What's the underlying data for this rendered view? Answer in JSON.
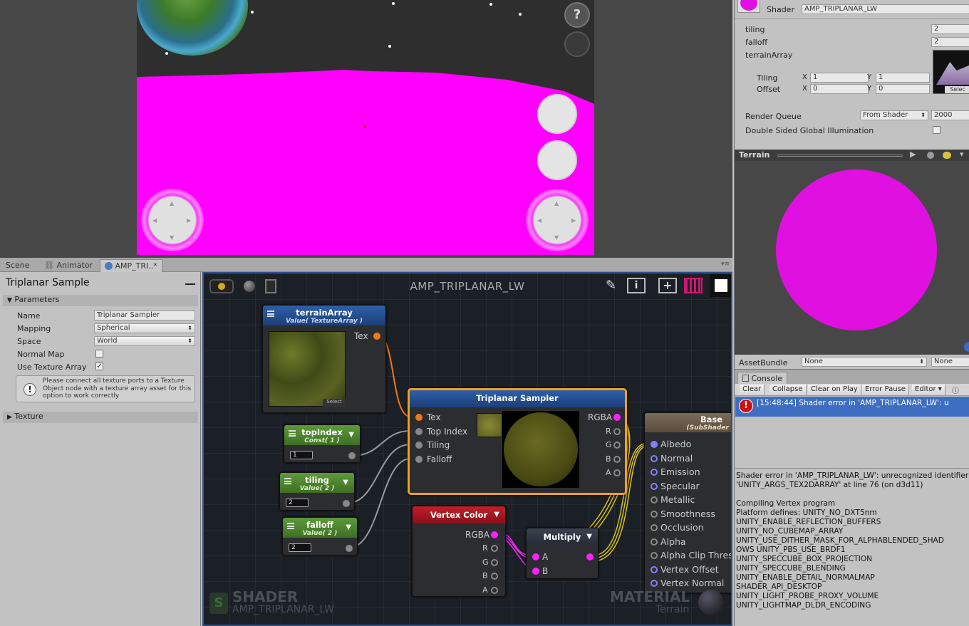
{
  "game": {
    "help_button": "?"
  },
  "tabs": [
    {
      "label": "Scene"
    },
    {
      "label": "Animator"
    },
    {
      "label": "AMP_TRI..*"
    }
  ],
  "left_panel": {
    "title": "Triplanar Sample",
    "section_parameters": "Parameters",
    "name_label": "Name",
    "name_value": "Triplanar Sampler",
    "mapping_label": "Mapping",
    "mapping_value": "Spherical",
    "space_label": "Space",
    "space_value": "World",
    "normal_map_label": "Normal Map",
    "use_texture_array_label": "Use Texture Array",
    "use_texture_array_checked": "✓",
    "info_text": "Please connect all texture ports to a Texture Object node with a texture array asset for this option to work correctly",
    "section_texture": "Texture"
  },
  "canvas": {
    "title": "AMP_TRIPLANAR_LW",
    "info_icon": "i",
    "watermark_shader": "SHADER",
    "watermark_shader_name": "AMP_TRIPLANAR_LW",
    "watermark_material": "MATERIAL",
    "watermark_material_name": "Terrain",
    "nodes": {
      "terrain_array": {
        "title": "terrainArray",
        "subtitle": "Value( TextureArray )",
        "port_tex": "Tex",
        "select": "Select"
      },
      "top_index": {
        "title": "topIndex",
        "subtitle": "Const( 1 )",
        "value": "1"
      },
      "tiling": {
        "title": "tiling",
        "subtitle": "Value( 2 )",
        "value": "2"
      },
      "falloff": {
        "title": "falloff",
        "subtitle": "Value( 2 )",
        "value": "2"
      },
      "triplanar": {
        "title": "Triplanar Sampler",
        "in_ports": [
          "Tex",
          "Top Index",
          "Tiling",
          "Falloff"
        ],
        "out_ports": [
          "RGBA",
          "R",
          "G",
          "B",
          "A"
        ]
      },
      "vertex_color": {
        "title": "Vertex Color",
        "out_ports": [
          "RGBA",
          "R",
          "G",
          "B",
          "A"
        ]
      },
      "multiply": {
        "title": "Multiply",
        "in_ports": [
          "A",
          "B"
        ]
      },
      "base": {
        "title": "Base",
        "subtitle": "(SubShader 0 P",
        "in_ports": [
          "Albedo",
          "Normal",
          "Emission",
          "Specular",
          "Metallic",
          "Smoothness",
          "Occlusion",
          "Alpha",
          "Alpha Clip Thres",
          "Vertex Offset",
          "Vertex Normal"
        ]
      }
    }
  },
  "inspector": {
    "shader_label": "Shader",
    "shader_value": "AMP_TRIPLANAR_LW",
    "tiling_label": "tiling",
    "tiling_value": "2",
    "falloff_label": "falloff",
    "falloff_value": "2",
    "terrain_array_label": "terrainArray",
    "tex_tiling_label": "Tiling",
    "tex_offset_label": "Offset",
    "x_label": "X",
    "y_label": "Y",
    "tiling_x": "1",
    "tiling_y": "1",
    "offset_x": "0",
    "offset_y": "0",
    "select_label": "Selec",
    "render_queue_label": "Render Queue",
    "render_queue_mode": "From Shader",
    "render_queue_value": "2000",
    "dsgi_label": "Double Sided Global Illumination",
    "preview_title": "Terrain",
    "asset_bundle_label": "AssetBundle",
    "asset_bundle_value": "None",
    "asset_bundle_variant": "None"
  },
  "console": {
    "tab_label": "Console",
    "buttons": [
      "Clear",
      "Collapse",
      "Clear on Play",
      "Error Pause",
      "Editor"
    ],
    "entry": "[15:48:44] Shader error in 'AMP_TRIPLANAR_LW': u",
    "details": "Shader error in 'AMP_TRIPLANAR_LW': unrecognized identifier 'UNITY_ARGS_TEX2DARRAY' at line 76 (on d3d11)\n\nCompiling Vertex program\nPlatform defines: UNITY_NO_DXT5nm\nUNITY_ENABLE_REFLECTION_BUFFERS\nUNITY_NO_CUBEMAP_ARRAY\nUNITY_USE_DITHER_MASK_FOR_ALPHABLENDED_SHAD\nOWS UNITY_PBS_USE_BRDF1\nUNITY_SPECCUBE_BOX_PROJECTION\nUNITY_SPECCUBE_BLENDING\nUNITY_ENABLE_DETAIL_NORMALMAP\nSHADER_API_DESKTOP\nUNITY_LIGHT_PROBE_PROXY_VOLUME\nUNITY_LIGHTMAP_DLDR_ENCODING"
  },
  "colors": {
    "magenta": "#ff00ff",
    "node_blue": "#1c3f78",
    "node_green": "#3f6e24",
    "node_red": "#8a1018",
    "selection_orange": "#f0a020",
    "console_error": "#cc1111"
  }
}
